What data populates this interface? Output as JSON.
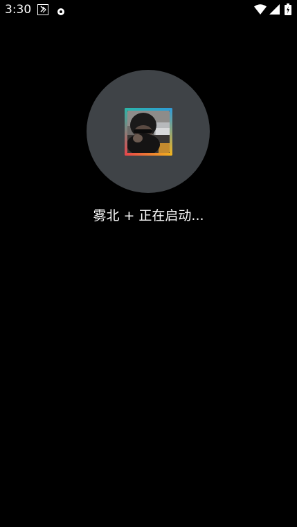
{
  "status_bar": {
    "time": "3:30",
    "left_icons": [
      "app-notification-icon",
      "record-dot-icon"
    ],
    "right_icons": [
      "wifi-icon",
      "cell-signal-icon",
      "battery-charging-icon"
    ]
  },
  "splash": {
    "app_icon": "app-icon-photo-with-gradient-frame",
    "loading_text": "雾北 + 正在启动..."
  },
  "colors": {
    "background": "#000000",
    "circle": "#3f4347",
    "frame_teal": "#2bb6a8",
    "frame_blue": "#2f9bd8",
    "frame_red": "#e8454a",
    "frame_yellow": "#f2b21c"
  }
}
